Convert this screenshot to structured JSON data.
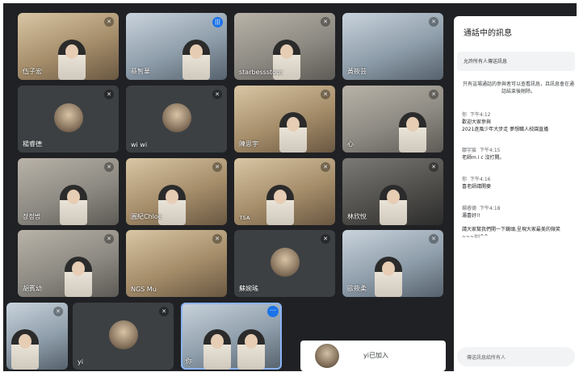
{
  "participants": [
    {
      "name": "伍子宏"
    },
    {
      "name": "蔡智華"
    },
    {
      "name": "starbessstops"
    },
    {
      "name": "黃筱芸"
    },
    {
      "name": "楊睿德"
    },
    {
      "name": "wi wi"
    },
    {
      "name": "陳思宇"
    },
    {
      "name": "心"
    },
    {
      "name": "장정법"
    },
    {
      "name": "圓紀Chloe"
    },
    {
      "name": "ᴛsᴀ"
    },
    {
      "name": "林欣悅"
    },
    {
      "name": "胡賓幼"
    },
    {
      "name": "NGS Mu"
    },
    {
      "name": "蘇婉瑤"
    },
    {
      "name": "歐筱柔"
    },
    {
      "name": ""
    },
    {
      "name": "yi"
    },
    {
      "name": "你"
    }
  ],
  "join_notice": "yi已加入",
  "chat": {
    "title": "通話中的訊息",
    "allow_toggle_label": "允許所有人傳送訊息",
    "info": "只有這場通話的參與者可以查看訊息，且訊息會在通話結束後刪除。",
    "messages": [
      {
        "sender": "你",
        "time": "下午4:12",
        "lines": [
          "歡迎大家參與",
          "2021逐風少年大步走 夢想職人校園直播"
        ]
      },
      {
        "sender": "鄒宇宸",
        "time": "下午4:15",
        "lines": [
          "老師m i c 沒打開。"
        ]
      },
      {
        "sender": "你",
        "time": "下午4:16",
        "lines": [
          "喜老師請開麥"
        ]
      },
      {
        "sender": "楊睿德",
        "time": "下午4:18",
        "lines": [
          "湯喜好!!"
        ]
      },
      {
        "sender": "",
        "time": "",
        "lines": [
          "請大家幫我們開一下鏡頭,呈現大家最美的微笑~~~!!!^^"
        ]
      }
    ],
    "input_placeholder": "傳送訊息給所有人"
  }
}
